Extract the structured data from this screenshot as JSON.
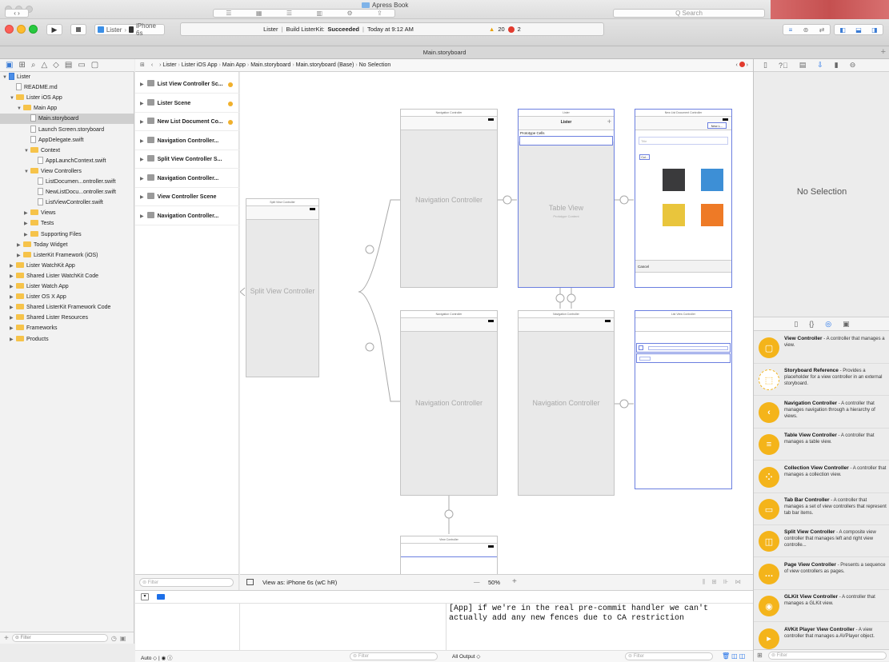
{
  "window": {
    "title": "Apress Book",
    "search_placeholder": "Q Search"
  },
  "toolbar": {
    "scheme": "Lister",
    "device": "iPhone 6s",
    "activity_project": "Lister",
    "activity_status_prefix": "Build ListerKit:",
    "activity_status": "Succeeded",
    "activity_time": "Today at 9:12 AM",
    "warnings": "20",
    "errors": "2"
  },
  "tab_title": "Main.storyboard",
  "navigator": {
    "items": [
      {
        "label": "Lister",
        "indent": 0,
        "kind": "project",
        "disc": "▼"
      },
      {
        "label": "README.md",
        "indent": 1,
        "kind": "file",
        "disc": ""
      },
      {
        "label": "Lister iOS App",
        "indent": 1,
        "kind": "folder",
        "disc": "▼"
      },
      {
        "label": "Main App",
        "indent": 2,
        "kind": "folder",
        "disc": "▼"
      },
      {
        "label": "Main.storyboard",
        "indent": 3,
        "kind": "file",
        "disc": "",
        "selected": true
      },
      {
        "label": "Launch Screen.storyboard",
        "indent": 3,
        "kind": "file",
        "disc": ""
      },
      {
        "label": "AppDelegate.swift",
        "indent": 3,
        "kind": "file",
        "disc": ""
      },
      {
        "label": "Context",
        "indent": 3,
        "kind": "folder",
        "disc": "▼"
      },
      {
        "label": "AppLaunchContext.swift",
        "indent": 4,
        "kind": "file",
        "disc": ""
      },
      {
        "label": "View Controllers",
        "indent": 3,
        "kind": "folder",
        "disc": "▼"
      },
      {
        "label": "ListDocumen...ontroller.swift",
        "indent": 4,
        "kind": "file",
        "disc": ""
      },
      {
        "label": "NewListDocu...ontroller.swift",
        "indent": 4,
        "kind": "file",
        "disc": ""
      },
      {
        "label": "ListViewController.swift",
        "indent": 4,
        "kind": "file",
        "disc": ""
      },
      {
        "label": "Views",
        "indent": 3,
        "kind": "folder",
        "disc": "▶"
      },
      {
        "label": "Tests",
        "indent": 3,
        "kind": "folder",
        "disc": "▶"
      },
      {
        "label": "Supporting Files",
        "indent": 3,
        "kind": "folder",
        "disc": "▶"
      },
      {
        "label": "Today Widget",
        "indent": 2,
        "kind": "folder",
        "disc": "▶"
      },
      {
        "label": "ListerKit Framework (iOS)",
        "indent": 2,
        "kind": "folder",
        "disc": "▶"
      },
      {
        "label": "Lister WatchKit App",
        "indent": 1,
        "kind": "folder",
        "disc": "▶"
      },
      {
        "label": "Shared Lister WatchKit Code",
        "indent": 1,
        "kind": "folder",
        "disc": "▶"
      },
      {
        "label": "Lister Watch App",
        "indent": 1,
        "kind": "folder",
        "disc": "▶"
      },
      {
        "label": "Lister OS X App",
        "indent": 1,
        "kind": "folder",
        "disc": "▶"
      },
      {
        "label": "Shared ListerKit Framework Code",
        "indent": 1,
        "kind": "folder",
        "disc": "▶"
      },
      {
        "label": "Shared Lister Resources",
        "indent": 1,
        "kind": "folder",
        "disc": "▶"
      },
      {
        "label": "Frameworks",
        "indent": 1,
        "kind": "folder",
        "disc": "▶"
      },
      {
        "label": "Products",
        "indent": 1,
        "kind": "folder",
        "disc": "▶"
      }
    ],
    "filter_placeholder": "Filter"
  },
  "jumpbar": {
    "crumbs": [
      "Lister",
      "Lister iOS App",
      "Main App",
      "Main.storyboard",
      "Main.storyboard (Base)",
      "No Selection"
    ]
  },
  "outline": {
    "items": [
      "List View Controller Sc...",
      "Lister Scene",
      "New List Document Co...",
      "Navigation Controller...",
      "Split View Controller S...",
      "Navigation Controller...",
      "View Controller Scene",
      "Navigation Controller..."
    ],
    "filter_placeholder": "Filter"
  },
  "canvas": {
    "split_title": "Split View Controller",
    "split_label": "Split View Controller",
    "nav_title": "Navigation Controller",
    "nav_label": "Navigation Controller",
    "lister_title": "Lister",
    "prototype_cells": "Prototype Cells",
    "table_view": "Table View",
    "prototype_content": "Prototype Content",
    "new_list_title": "New List Document Controller",
    "new_list_btn": "New L...",
    "title_field": "Title",
    "col_label": "Col...",
    "cancel": "Cancel",
    "list_view_title": "List View Controller",
    "view_controller_title": "View Controller",
    "swatches": [
      "#3a3a3c",
      "#3d8fd6",
      "#e9c53c",
      "#ee7a26"
    ]
  },
  "bottom": {
    "view_as": "View as: iPhone 6s (wC hR)",
    "zoom": "50%",
    "minus": "—",
    "plus": "+"
  },
  "debug": {
    "auto": "Auto",
    "filter_placeholder": "Filter",
    "all_output": "All Output",
    "console_text": "[App] if we're in the real pre-commit handler we can't actually add any new fences due to CA restriction"
  },
  "inspector": {
    "no_selection": "No Selection",
    "library": [
      {
        "title": "View Controller",
        "desc": " - A controller that manages a view.",
        "glyph": "▢"
      },
      {
        "title": "Storyboard Reference",
        "desc": " - Provides a placeholder for a view controller in an external storyboard.",
        "glyph": "⬚"
      },
      {
        "title": "Navigation Controller",
        "desc": " - A controller that manages navigation through a hierarchy of views.",
        "glyph": "‹"
      },
      {
        "title": "Table View Controller",
        "desc": " - A controller that manages a table view.",
        "glyph": "≡"
      },
      {
        "title": "Collection View Controller",
        "desc": " - A controller that manages a collection view.",
        "glyph": "⁘"
      },
      {
        "title": "Tab Bar Controller",
        "desc": " - A controller that manages a set of view controllers that represent tab bar items.",
        "glyph": "▭"
      },
      {
        "title": "Split View Controller",
        "desc": " - A composite view controller that manages left and right view controlle...",
        "glyph": "◫"
      },
      {
        "title": "Page View Controller",
        "desc": " - Presents a sequence of view controllers as pages.",
        "glyph": "…"
      },
      {
        "title": "GLKit View Controller",
        "desc": " - A controller that manages a GLKit view.",
        "glyph": "◉"
      },
      {
        "title": "AVKit Player View Controller",
        "desc": " - A view controller that manages a AVPlayer object.",
        "glyph": "▸"
      }
    ],
    "filter_placeholder": "Filter"
  }
}
